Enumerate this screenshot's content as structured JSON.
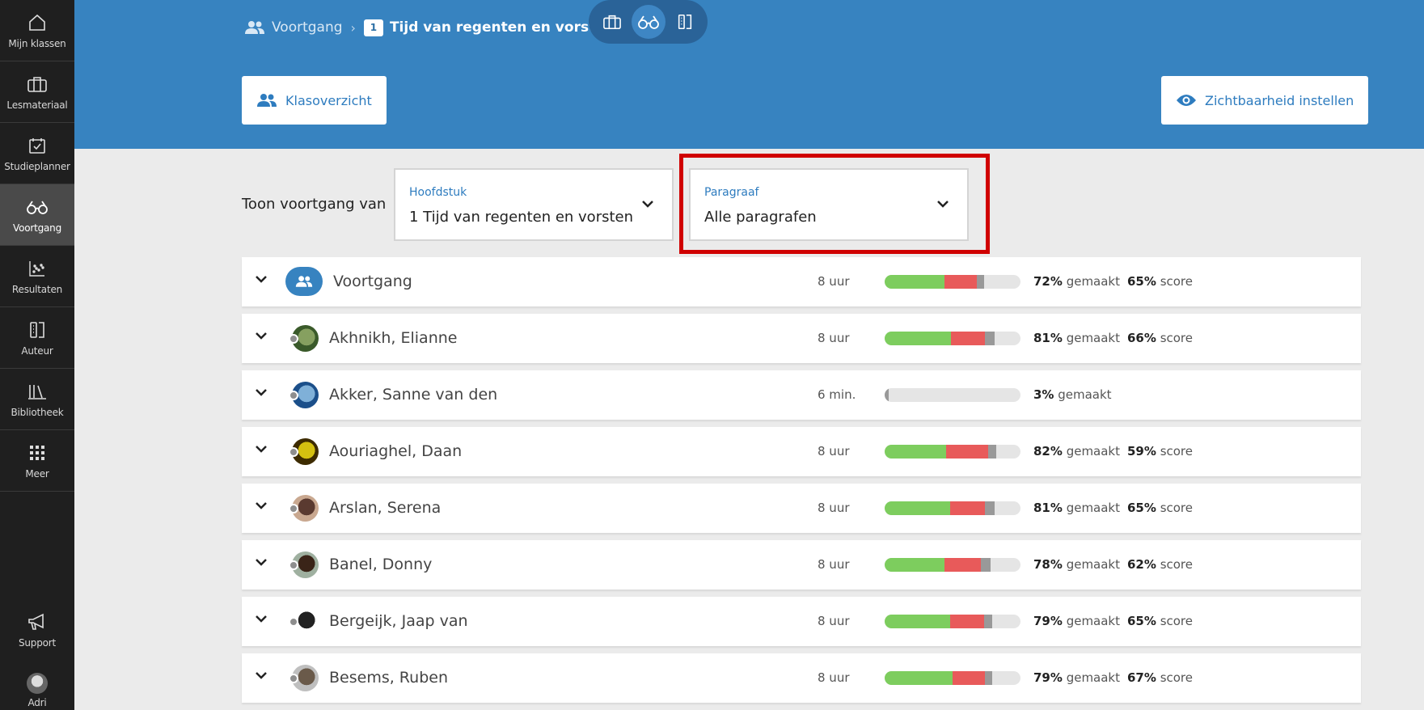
{
  "sidebar": {
    "items": [
      {
        "label": "Mijn klassen",
        "icon": "home-icon"
      },
      {
        "label": "Lesmateriaal",
        "icon": "briefcase-icon"
      },
      {
        "label": "Studieplanner",
        "icon": "calendar-check-icon"
      },
      {
        "label": "Voortgang",
        "icon": "glasses-icon",
        "active": true
      },
      {
        "label": "Resultaten",
        "icon": "scatter-chart-icon"
      },
      {
        "label": "Auteur",
        "icon": "author-icon"
      },
      {
        "label": "Bibliotheek",
        "icon": "library-icon"
      },
      {
        "label": "Meer",
        "icon": "grid-icon"
      }
    ],
    "support_label": "Support",
    "user_label": "Adri"
  },
  "header": {
    "crumb_progress": "Voortgang",
    "crumb_number": "1",
    "crumb_title": "Tijd van regenten en vorsten",
    "class_overview_label": "Klasoverzicht",
    "visibility_label": "Zichtbaarheid instellen"
  },
  "filters": {
    "label": "Toon voortgang van",
    "chapter": {
      "label": "Hoofdstuk",
      "value": "1 Tijd van regenten en vorsten"
    },
    "paragraph": {
      "label": "Paragraaf",
      "value": "Alle paragrafen"
    }
  },
  "units": {
    "made": "gemaakt",
    "score": "score"
  },
  "colors": {
    "accent": "#3783c0",
    "done": "#7dcd5e",
    "wrong": "#e85a5a",
    "other": "#999999",
    "highlight": "#d00000"
  },
  "rows": [
    {
      "name": "Voortgang",
      "time": "8 uur",
      "made_pct": "72%",
      "score_pct": "65%",
      "green": 0.44,
      "red": 0.24,
      "grey": 0.05,
      "group": true
    },
    {
      "name": "Akhnikh, Elianne",
      "time": "8 uur",
      "made_pct": "81%",
      "score_pct": "66%",
      "green": 0.49,
      "red": 0.25,
      "grey": 0.07
    },
    {
      "name": "Akker, Sanne van den",
      "time": "6 min.",
      "made_pct": "3%",
      "score_pct": "",
      "green": 0,
      "red": 0,
      "grey": 0.03
    },
    {
      "name": "Aouriaghel, Daan",
      "time": "8 uur",
      "made_pct": "82%",
      "score_pct": "59%",
      "green": 0.45,
      "red": 0.31,
      "grey": 0.06
    },
    {
      "name": "Arslan, Serena",
      "time": "8 uur",
      "made_pct": "81%",
      "score_pct": "65%",
      "green": 0.48,
      "red": 0.26,
      "grey": 0.07
    },
    {
      "name": "Banel, Donny",
      "time": "8 uur",
      "made_pct": "78%",
      "score_pct": "62%",
      "green": 0.44,
      "red": 0.27,
      "grey": 0.07
    },
    {
      "name": "Bergeijk, Jaap van",
      "time": "8 uur",
      "made_pct": "79%",
      "score_pct": "65%",
      "green": 0.48,
      "red": 0.25,
      "grey": 0.06
    },
    {
      "name": "Besems, Ruben",
      "time": "8 uur",
      "made_pct": "79%",
      "score_pct": "67%",
      "green": 0.5,
      "red": 0.24,
      "grey": 0.05
    }
  ]
}
